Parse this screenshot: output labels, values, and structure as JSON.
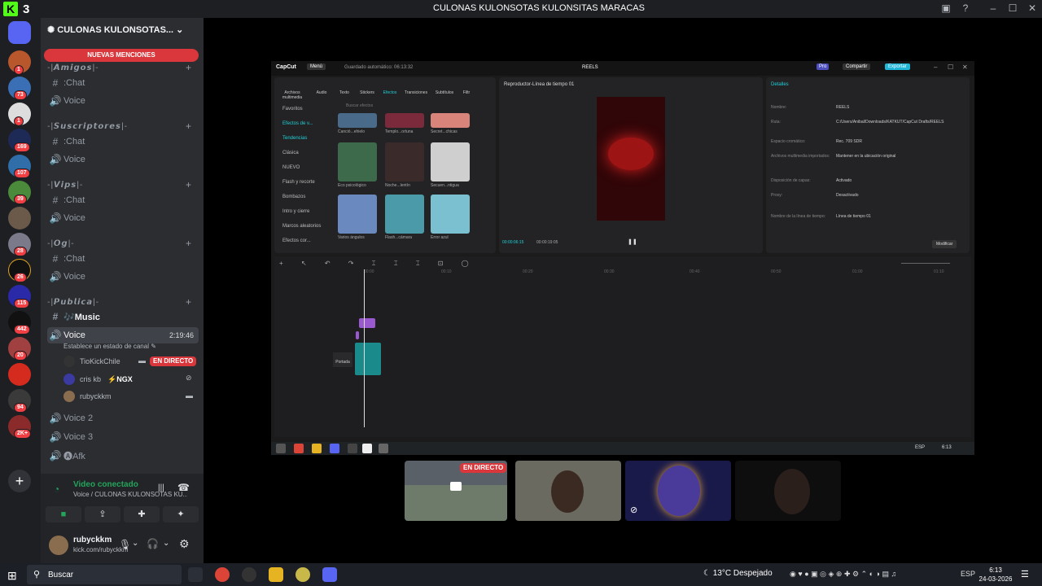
{
  "window": {
    "title": "CULONAS KULONSOTAS KULONSITAS MARACAS",
    "app_count": "3"
  },
  "servers": {
    "badges": [
      "1",
      "73",
      "1",
      "169",
      "107",
      "39",
      "28",
      "26",
      "115",
      "442",
      "20",
      "94",
      "2K+"
    ]
  },
  "channel_list": {
    "server_name": "CULONAS KULONSOTAS...",
    "new_mentions": "NUEVAS MENCIONES",
    "categories": [
      {
        "label": "-|𝘼𝙢𝙞𝙜𝙤𝙨|-",
        "chat": ":Chat",
        "voice": "Voice"
      },
      {
        "label": "-|𝙎𝙪𝙨𝙘𝙧𝙞𝙥𝙩𝙤𝙧𝙚𝙨|-",
        "chat": ":Chat",
        "voice": "Voice"
      },
      {
        "label": "-|𝙑𝙞𝙥𝙨|-",
        "chat": ":Chat",
        "voice": "Voice"
      },
      {
        "label": "-|𝙊𝙜|-",
        "chat": ":Chat",
        "voice": "Voice"
      },
      {
        "label": "-|𝙋𝙪𝙗𝙡𝙞𝙘𝙖|-",
        "chat": "🎶Music",
        "voice": "Voice"
      }
    ],
    "voice_time": "2:19:46",
    "set_status": "Establece un estado de canal",
    "voice_users": [
      {
        "name": "TioKickChile",
        "badge": "EN DIRECTO"
      },
      {
        "name": "cris kb",
        "tag": "⚡NGX"
      },
      {
        "name": "rubyckkm"
      }
    ],
    "extra_channels": [
      "Voice 2",
      "Voice 3",
      "🅐Afk"
    ]
  },
  "voice_panel": {
    "status": "Video conectado",
    "path": "Voice / CULONAS KULONSOTAS KU..."
  },
  "user_panel": {
    "name": "rubyckkm",
    "subtitle": "kick.com/rubyckkm"
  },
  "capcut": {
    "logo": "CapCut",
    "menu": "Menú",
    "saved": "Guardado automático: 06:13:32",
    "title": "REELS",
    "pro": "Pro",
    "share": "Compartir",
    "export": "Exportar",
    "tools": [
      "Archivos multimedia",
      "Audio",
      "Texto",
      "Stickers",
      "Efectos",
      "Transiciones",
      "Subtítulos",
      "Filtr"
    ],
    "side": [
      "Favoritos",
      "Efectos de v...",
      "Tendencias",
      "Clásica",
      "NUEVO",
      "Flash y recorte",
      "Bombazos",
      "Intro y cierre",
      "Marcos aleatorios",
      "Efectos cor..."
    ],
    "search": "Buscar efectos",
    "thumbs": [
      "Canció...ehielo",
      "Templo...ortuna",
      "Secret...chicas",
      "Eco psicológico",
      "Noche...lentín",
      "Secuen...ntigua",
      "Varios ángulos",
      "Flash...cámara",
      "Error azul"
    ],
    "player_title": "Reproductor-Línea de tiempo 01",
    "time_current": "00:00:06:15",
    "time_total": "00:00:19:05",
    "details_title": "Detalles",
    "details": [
      {
        "k": "Nombre:",
        "v": "REELS"
      },
      {
        "k": "Ruta:",
        "v": "C:/Users/Anibal/Downloads/KATKUT/CapCut Drafts/REELS"
      },
      {
        "k": "Espacio cromático:",
        "v": "Rec. 709 SDR"
      },
      {
        "k": "Archivos multimedia importados:",
        "v": "Mantener en la ubicación original"
      },
      {
        "k": "Disposición de capas:",
        "v": "Activado"
      },
      {
        "k": "Proxy:",
        "v": "Desactivado"
      },
      {
        "k": "Nombre de la línea de tiempo:",
        "v": "Línea de tiempo 01"
      }
    ],
    "modify": "Modificar",
    "cover": "Portada",
    "ruler": [
      "00:00",
      "00:10",
      "00:20",
      "00:30",
      "00:40",
      "00:50",
      "01:00",
      "01:10"
    ],
    "taskbar_lang": "ESP",
    "taskbar_time": "6:13"
  },
  "tiles": {
    "live_badge": "EN DIRECTO"
  },
  "taskbar": {
    "search": "Buscar",
    "weather": "13°C  Despejado",
    "lang": "ESP",
    "time": "6:13",
    "date": "24-03-2026"
  }
}
